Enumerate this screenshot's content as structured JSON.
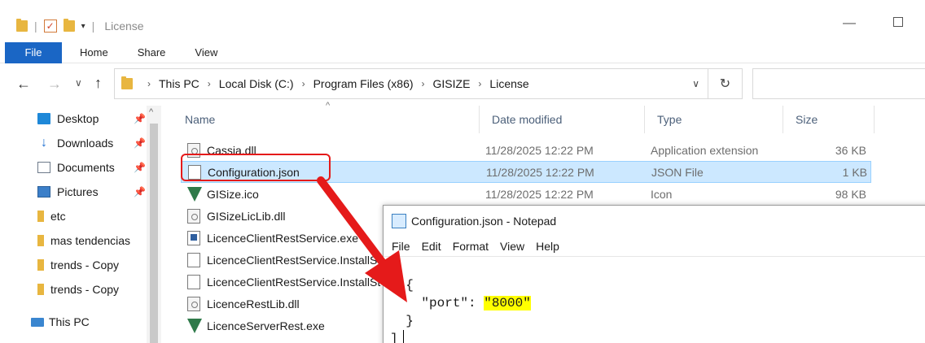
{
  "window": {
    "title": "License",
    "minimize": "—",
    "maximize": ""
  },
  "ribbon": {
    "file": "File",
    "home": "Home",
    "share": "Share",
    "view": "View"
  },
  "address": {
    "crumbs": [
      "This PC",
      "Local Disk (C:)",
      "Program Files (x86)",
      "GISIZE",
      "License"
    ]
  },
  "sidebar": {
    "items": [
      {
        "label": "Desktop",
        "icon": "desktop-icon",
        "pinned": true
      },
      {
        "label": "Downloads",
        "icon": "downloads-icon",
        "pinned": true
      },
      {
        "label": "Documents",
        "icon": "documents-icon",
        "pinned": true
      },
      {
        "label": "Pictures",
        "icon": "pictures-icon",
        "pinned": true
      },
      {
        "label": "etc",
        "icon": "folder-icon",
        "pinned": false
      },
      {
        "label": "mas tendencias",
        "icon": "folder-icon",
        "pinned": false
      },
      {
        "label": "trends - Copy",
        "icon": "folder-icon",
        "pinned": false
      },
      {
        "label": "trends - Copy",
        "icon": "folder-icon",
        "pinned": false
      }
    ],
    "this_pc": "This PC"
  },
  "columns": {
    "name": "Name",
    "date": "Date modified",
    "type": "Type",
    "size": "Size"
  },
  "files": [
    {
      "name": "Cassia.dll",
      "date": "11/28/2025 12:22 PM",
      "type": "Application extension",
      "size": "36 KB",
      "icon": "dll-icon"
    },
    {
      "name": "Configuration.json",
      "date": "11/28/2025 12:22 PM",
      "type": "JSON File",
      "size": "1 KB",
      "icon": "json-file-icon"
    },
    {
      "name": "GISize.ico",
      "date": "11/28/2025 12:22 PM",
      "type": "Icon",
      "size": "98 KB",
      "icon": "gisize-icon"
    },
    {
      "name": "GISizeLicLib.dll",
      "icon": "dll-icon"
    },
    {
      "name": "LicenceClientRestService.exe",
      "icon": "exe-icon"
    },
    {
      "name": "LicenceClientRestService.InstallS",
      "icon": "file-icon"
    },
    {
      "name": "LicenceClientRestService.InstallSt",
      "icon": "file-icon"
    },
    {
      "name": "LicenceRestLib.dll",
      "icon": "dll-icon"
    },
    {
      "name": "LicenceServerRest.exe",
      "icon": "gisize-icon"
    }
  ],
  "notepad": {
    "title": "Configuration.json - Notepad",
    "menu": [
      "File",
      "Edit",
      "Format",
      "View",
      "Help"
    ],
    "lines": {
      "open_bracket": "[",
      "open_brace": "  {",
      "key": "    \"port\": ",
      "value": "\"8000\"",
      "close_brace": "  }",
      "close_bracket": "]"
    }
  },
  "colors": {
    "accent": "#1a66c5",
    "selection": "#cce8ff",
    "annotation": "#e51a1a",
    "highlight": "#ffff00"
  }
}
